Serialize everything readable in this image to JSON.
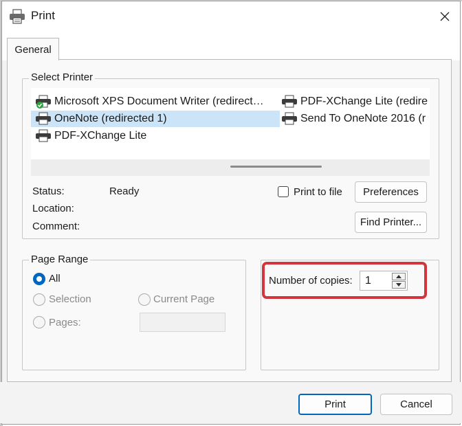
{
  "window": {
    "title": "Print"
  },
  "tabs": [
    {
      "label": "General",
      "selected": true
    }
  ],
  "select_printer": {
    "legend": "Select Printer",
    "printers": [
      {
        "label": "Microsoft XPS Document Writer (redirect…",
        "icon": "printer-default-icon",
        "selected": false
      },
      {
        "label": "PDF-XChange Lite (redire",
        "icon": "printer-icon",
        "selected": false
      },
      {
        "label": "OneNote (redirected 1)",
        "icon": "printer-icon",
        "selected": true
      },
      {
        "label": "Send To OneNote 2016 (r",
        "icon": "printer-icon",
        "selected": false
      },
      {
        "label": "PDF-XChange Lite",
        "icon": "printer-icon",
        "selected": false
      }
    ],
    "status_label": "Status:",
    "status_value": "Ready",
    "location_label": "Location:",
    "location_value": "",
    "comment_label": "Comment:",
    "comment_value": "",
    "print_to_file_label": "Print to file",
    "print_to_file_checked": false,
    "preferences_button": "Preferences",
    "find_printer_button": "Find Printer..."
  },
  "page_range": {
    "legend": "Page Range",
    "all_label": "All",
    "selection_label": "Selection",
    "current_page_label": "Current Page",
    "pages_label": "Pages:",
    "pages_value": "",
    "selected_option": "All"
  },
  "copies": {
    "label": "Number of copies:",
    "value": "1"
  },
  "footer": {
    "print_button": "Print",
    "cancel_button": "Cancel"
  },
  "colors": {
    "accent": "#0067c0",
    "selection": "#cce4f7",
    "highlight": "#d2363c"
  }
}
